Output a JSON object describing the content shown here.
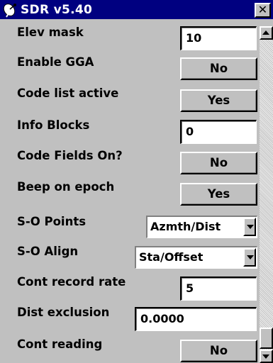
{
  "window": {
    "title": "SDR v5.40",
    "close_label": "✕",
    "app_icon": "satellite-dish-icon"
  },
  "settings": {
    "elev_mask": {
      "label": "Elev mask",
      "value": "10"
    },
    "enable_gga": {
      "label": "Enable GGA",
      "value": "No"
    },
    "code_list_active": {
      "label": "Code list active",
      "value": "Yes"
    },
    "info_blocks": {
      "label": "Info Blocks",
      "value": "0"
    },
    "code_fields_on": {
      "label": "Code Fields On?",
      "value": "No"
    },
    "beep_on_epoch": {
      "label": "Beep on epoch",
      "value": "Yes"
    },
    "so_points": {
      "label": "S-O Points",
      "value": "Azmth/Dist"
    },
    "so_align": {
      "label": "S-O Align",
      "value": "Sta/Offset"
    },
    "cont_record_rate": {
      "label": "Cont record rate",
      "value": "5"
    },
    "dist_exclusion": {
      "label": "Dist exclusion",
      "value": "0.0000"
    },
    "cont_reading": {
      "label": "Cont reading",
      "value": "No"
    }
  },
  "colors": {
    "titlebar": "#000080",
    "face": "#c0c0c0",
    "field": "#ffffff"
  }
}
